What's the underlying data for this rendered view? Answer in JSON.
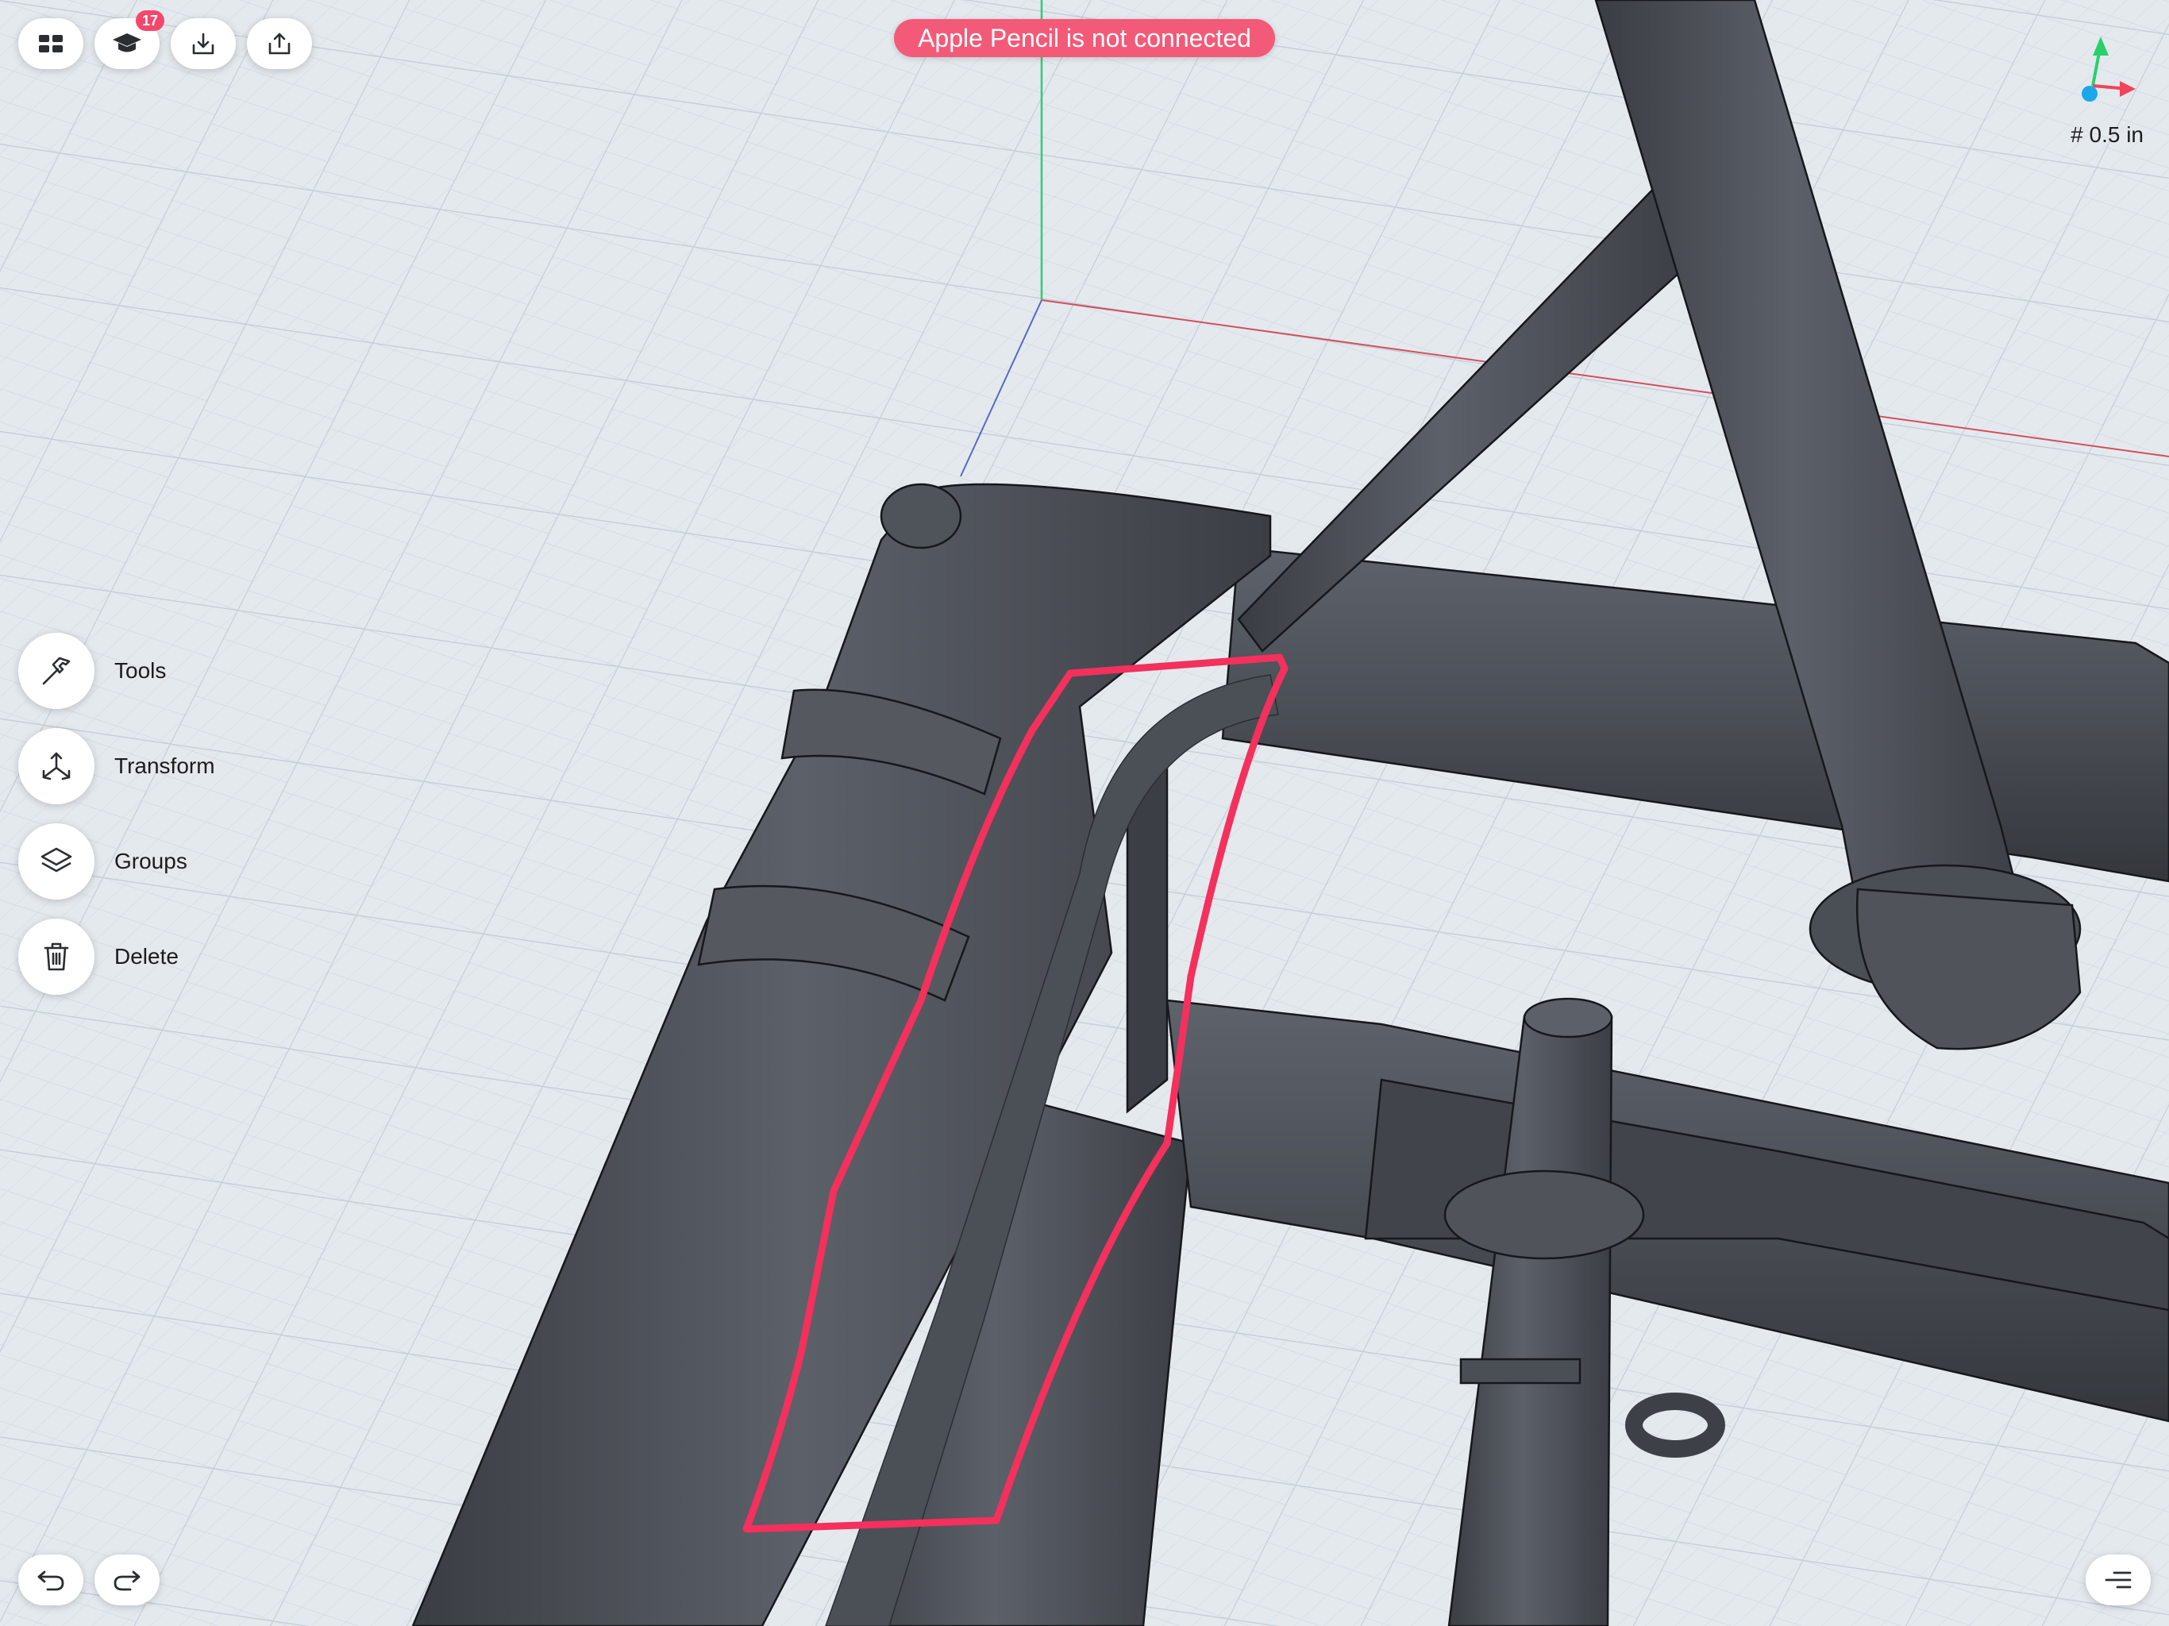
{
  "banner": {
    "text": "Apple Pencil is not connected"
  },
  "toolbar_top": {
    "learn_badge_count": "17"
  },
  "side_menu": {
    "items": [
      {
        "label": "Tools",
        "icon": "hammer-icon"
      },
      {
        "label": "Transform",
        "icon": "transform-icon"
      },
      {
        "label": "Groups",
        "icon": "layers-icon"
      },
      {
        "label": "Delete",
        "icon": "trash-icon"
      }
    ]
  },
  "grid": {
    "readout": "# 0.5 in"
  },
  "colors": {
    "background": "#e4e9ee",
    "model": "#4b4f56",
    "annotation": "#f4305d",
    "banner": "#f35a78",
    "axis_x": "#f0445a",
    "axis_y": "#2ccf6d",
    "axis_z": "#1ca8e8"
  }
}
